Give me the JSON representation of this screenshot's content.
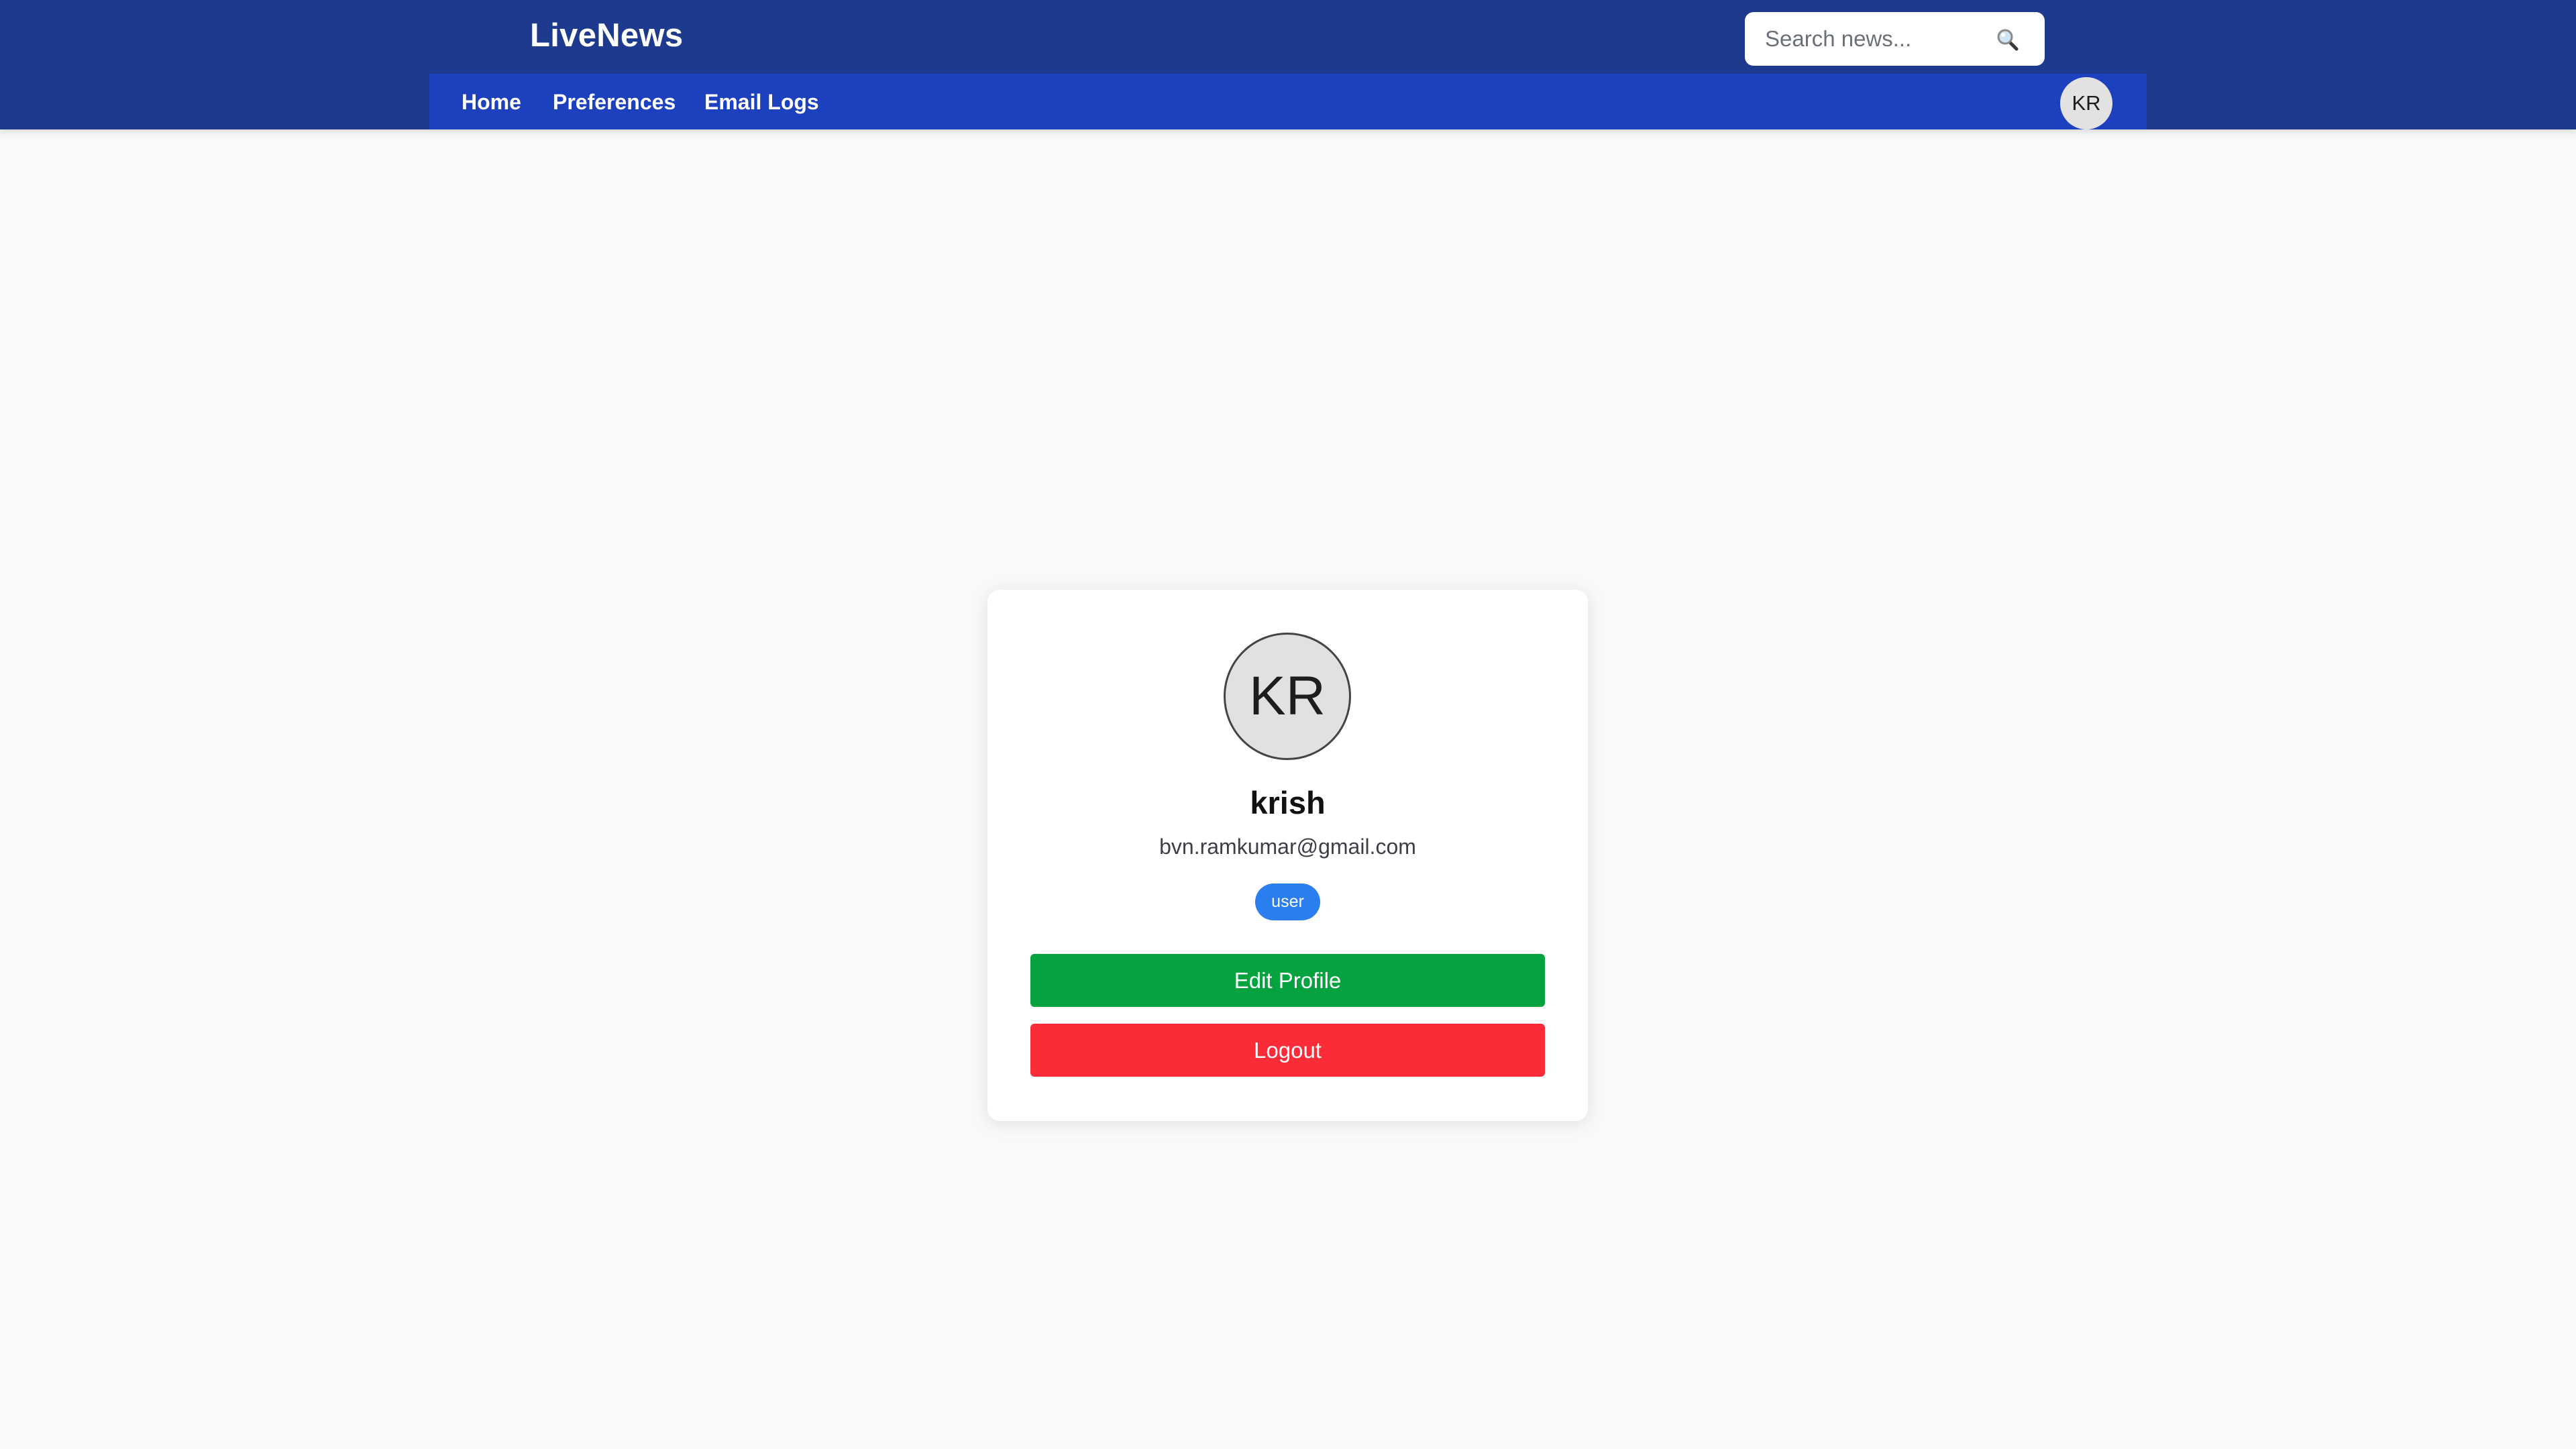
{
  "header": {
    "brand": "LiveNews",
    "search": {
      "placeholder": "Search news...",
      "value": ""
    },
    "nav": [
      {
        "label": "Home"
      },
      {
        "label": "Preferences"
      },
      {
        "label": "Email Logs"
      }
    ],
    "avatar_initials": "KR"
  },
  "profile": {
    "initials": "KR",
    "name": "krish",
    "email": "bvn.ramkumar@gmail.com",
    "role": "user",
    "edit_label": "Edit Profile",
    "logout_label": "Logout"
  },
  "icons": {
    "search": "search-icon"
  },
  "colors": {
    "header_bg": "#1e3a8f",
    "navbar_bg": "#1d40be",
    "page_bg": "#f8f9fb",
    "badge": "#2a7ef0",
    "edit_button": "#04a33f",
    "logout_button": "#fb2c38"
  }
}
